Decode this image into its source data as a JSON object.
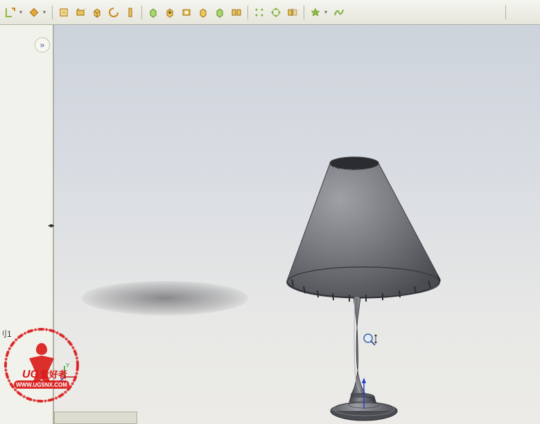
{
  "toolbar": {
    "groups": [
      {
        "items": [
          {
            "name": "sketch-icon",
            "color": "#8fb83a",
            "shape": "L"
          },
          {
            "name": "dropdown-1",
            "arrow": true
          },
          {
            "name": "extrude-icon",
            "color": "#e8a838",
            "shape": "diamond"
          },
          {
            "name": "dropdown-2",
            "arrow": true
          }
        ]
      },
      {
        "items": [
          {
            "name": "insert-icon",
            "color": "#c88820",
            "shape": "rect"
          },
          {
            "name": "surface-icon",
            "color": "#c88820",
            "shape": "rect"
          },
          {
            "name": "cube-icon",
            "color": "#c88820",
            "shape": "cube"
          },
          {
            "name": "revolve-icon",
            "color": "#c88820",
            "shape": "c"
          },
          {
            "name": "sweep-icon",
            "color": "#d8a820",
            "shape": "s-tall"
          }
        ]
      },
      {
        "items": [
          {
            "name": "extrude-boss-icon",
            "color": "#7db038",
            "shape": "cube"
          },
          {
            "name": "hole-icon",
            "color": "#c88820",
            "shape": "cube"
          },
          {
            "name": "cut-icon",
            "color": "#c88820",
            "shape": "rect"
          },
          {
            "name": "fillet-icon",
            "color": "#c88820",
            "shape": "cube"
          },
          {
            "name": "chamfer-icon",
            "color": "#7db038",
            "shape": "cube"
          },
          {
            "name": "pattern-icon",
            "color": "#c88820",
            "shape": "rect"
          }
        ]
      },
      {
        "items": [
          {
            "name": "linear-pattern-icon",
            "color": "#7db038",
            "shape": "grid"
          },
          {
            "name": "circular-pattern-icon",
            "color": "#7db038",
            "shape": "circ"
          },
          {
            "name": "mirror-icon",
            "color": "#c8a030",
            "shape": "rect"
          }
        ]
      },
      {
        "items": [
          {
            "name": "reference-icon",
            "color": "#8fb83a",
            "shape": "star"
          },
          {
            "name": "dropdown-3",
            "arrow": true
          },
          {
            "name": "curves-icon",
            "color": "#7db038",
            "shape": "spline"
          }
        ]
      }
    ]
  },
  "side_panel": {
    "collapse_symbol": "»",
    "splitter_symbol": "◂▸",
    "tree_text": "刂1"
  },
  "watermark": {
    "brand_prefix": "UG",
    "brand_suffix": "爱好者",
    "url": "WWW.UGSNX.COM"
  },
  "viewport": {
    "cursor_type": "zoom"
  }
}
